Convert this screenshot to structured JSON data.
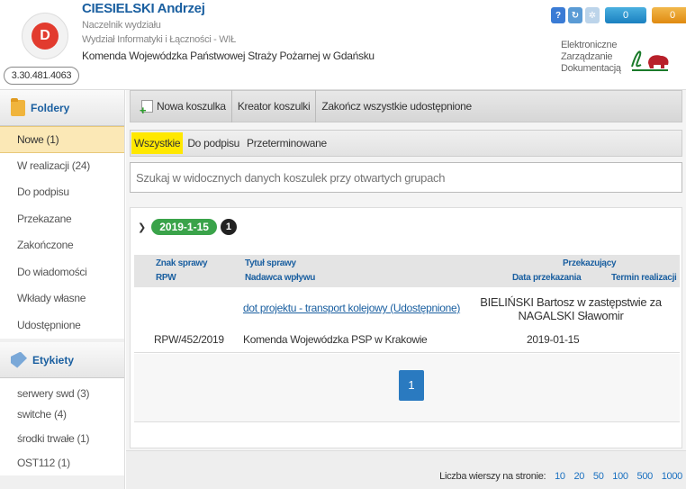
{
  "header": {
    "user_name": "CIESIELSKI Andrzej",
    "role": "Naczelnik wydziału",
    "department": "Wydział Informatyki i Łączności - WIŁ",
    "organization": "Komenda Wojewódzka Państwowej Straży Pożarnej w Gdańsku",
    "id_code": "3.30.481.4063",
    "badge_blue": "0",
    "badge_orange": "0",
    "ezd_line1": "Elektroniczne",
    "ezd_line2": "Zarządzanie",
    "ezd_line3": "Dokumentacją"
  },
  "sidebar": {
    "folders_title": "Foldery",
    "folders": [
      {
        "label": "Nowe (1)"
      },
      {
        "label": "W realizacji (24)"
      },
      {
        "label": "Do podpisu"
      },
      {
        "label": "Przekazane"
      },
      {
        "label": "Zakończone"
      },
      {
        "label": "Do wiadomości"
      },
      {
        "label": "Wkłady własne"
      },
      {
        "label": "Udostępnione"
      }
    ],
    "labels_title": "Etykiety",
    "labels": [
      {
        "label": "serwery swd (3)"
      },
      {
        "label": "switche (4)"
      },
      {
        "label": "środki trwałe (1)"
      },
      {
        "label": "OST112 (1)"
      }
    ]
  },
  "toolbar": {
    "new_folder": "Nowa koszulka",
    "wizard": "Kreator koszulki",
    "end_shared": "Zakończ wszystkie udostępnione"
  },
  "tabs": [
    {
      "label": "Wszystkie"
    },
    {
      "label": "Do podpisu"
    },
    {
      "label": "Przeterminowane"
    }
  ],
  "search": {
    "placeholder": "Szukaj w widocznych danych koszulek przy otwartych grupach"
  },
  "group": {
    "date": "2019-1-15",
    "count": "1"
  },
  "table": {
    "col_sign": "Znak sprawy",
    "col_rpw": "RPW",
    "col_title": "Tytuł sprawy",
    "col_sender": "Nadawca wpływu",
    "col_forwarding": "Przekazujący",
    "col_date": "Data przekazania",
    "col_deadline": "Termin realizacji",
    "row": {
      "title": "dot projektu - transport kolejowy (Udostępnione)",
      "forwarder": "BIELIŃSKI Bartosz w zastępstwie za NAGALSKI Sławomir",
      "rpw": "RPW/452/2019",
      "sender": "Komenda Wojewódzka PSP w Krakowie",
      "date": "2019-01-15"
    }
  },
  "pager": {
    "page": "1",
    "rows_label": "Liczba wierszy na stronie:",
    "options": [
      "10",
      "20",
      "50",
      "100",
      "500",
      "1000"
    ]
  },
  "colors": {
    "accent": "#1a5fa0",
    "active_tab": "#ffe800",
    "group_badge": "#3aa34a"
  }
}
